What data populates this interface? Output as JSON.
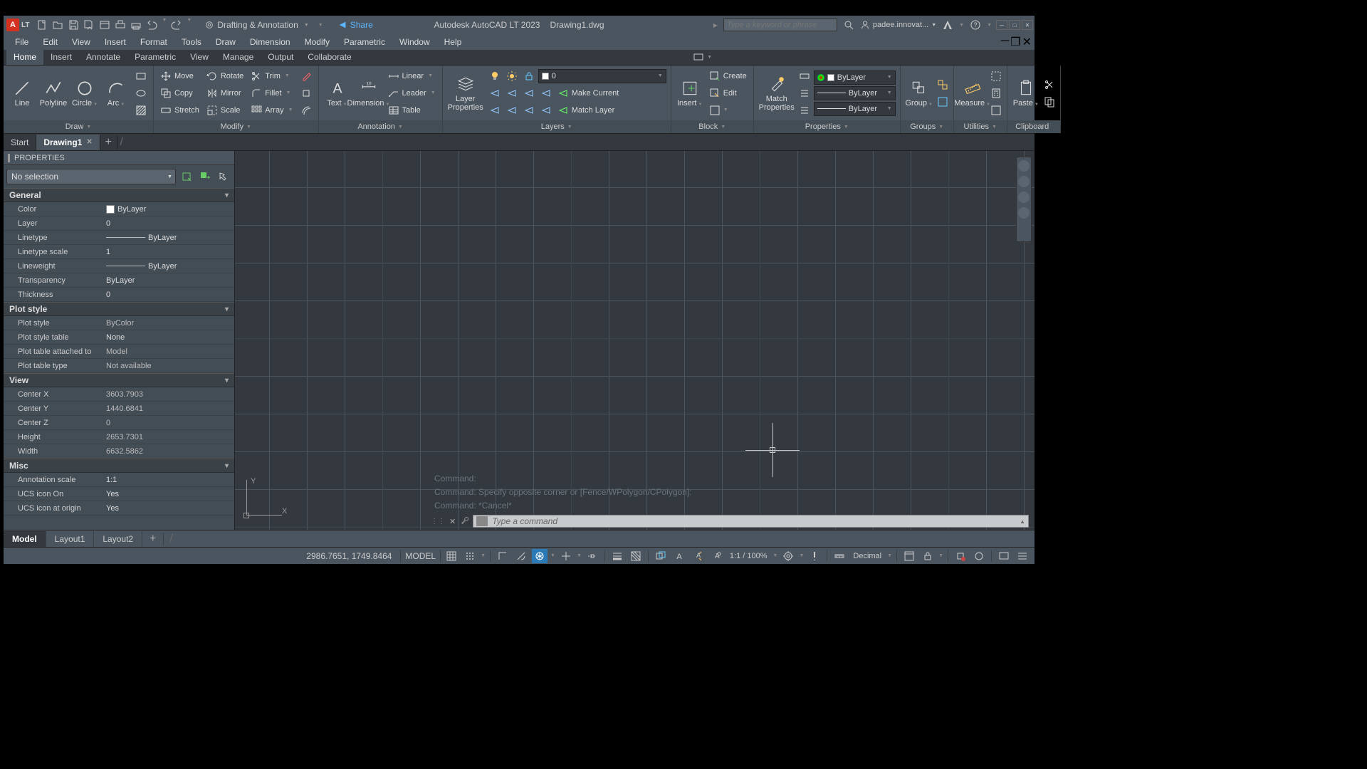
{
  "title": {
    "app": "Autodesk AutoCAD LT 2023",
    "doc": "Drawing1.dwg"
  },
  "workspace": "Drafting & Annotation",
  "share": "Share",
  "search": {
    "placeholder": "Type a keyword or phrase"
  },
  "user": "padee.innovat...",
  "menu": [
    "File",
    "Edit",
    "View",
    "Insert",
    "Format",
    "Tools",
    "Draw",
    "Dimension",
    "Modify",
    "Parametric",
    "Window",
    "Help"
  ],
  "ribbon_tabs": [
    "Home",
    "Insert",
    "Annotate",
    "Parametric",
    "View",
    "Manage",
    "Output",
    "Collaborate"
  ],
  "ribbon_active": 0,
  "panels": {
    "draw": {
      "title": "Draw",
      "line": "Line",
      "polyline": "Polyline",
      "circle": "Circle",
      "arc": "Arc"
    },
    "modify": {
      "title": "Modify",
      "move": "Move",
      "rotate": "Rotate",
      "trim": "Trim",
      "copy": "Copy",
      "mirror": "Mirror",
      "fillet": "Fillet",
      "stretch": "Stretch",
      "scale": "Scale",
      "array": "Array"
    },
    "annotation": {
      "title": "Annotation",
      "text": "Text",
      "dimension": "Dimension",
      "linear": "Linear",
      "leader": "Leader",
      "table": "Table"
    },
    "layers": {
      "title": "Layers",
      "props": "Layer\nProperties",
      "current": "0",
      "make_current": "Make Current",
      "match": "Match Layer"
    },
    "block": {
      "title": "Block",
      "insert": "Insert",
      "create": "Create",
      "edit": "Edit"
    },
    "properties": {
      "title": "Properties",
      "match": "Match\nProperties",
      "color": "ByLayer",
      "linew": "ByLayer",
      "ltype": "ByLayer"
    },
    "groups": {
      "title": "Groups",
      "group": "Group"
    },
    "utilities": {
      "title": "Utilities",
      "measure": "Measure"
    },
    "clipboard": {
      "title": "Clipboard",
      "paste": "Paste"
    }
  },
  "doc_tabs": {
    "start": "Start",
    "drawing": "Drawing1"
  },
  "palette": {
    "title": "PROPERTIES",
    "selection": "No selection",
    "sections": {
      "general": {
        "title": "General",
        "rows": [
          {
            "n": "Color",
            "v": "ByLayer",
            "swatch": true
          },
          {
            "n": "Layer",
            "v": "0"
          },
          {
            "n": "Linetype",
            "v": "ByLayer",
            "line": true
          },
          {
            "n": "Linetype scale",
            "v": "1"
          },
          {
            "n": "Lineweight",
            "v": "ByLayer",
            "line": true
          },
          {
            "n": "Transparency",
            "v": "ByLayer"
          },
          {
            "n": "Thickness",
            "v": "0"
          }
        ]
      },
      "plot": {
        "title": "Plot style",
        "rows": [
          {
            "n": "Plot style",
            "v": "ByColor",
            "ro": true
          },
          {
            "n": "Plot style table",
            "v": "None"
          },
          {
            "n": "Plot table attached to",
            "v": "Model",
            "ro": true
          },
          {
            "n": "Plot table type",
            "v": "Not available",
            "ro": true
          }
        ]
      },
      "view": {
        "title": "View",
        "rows": [
          {
            "n": "Center X",
            "v": "3603.7903",
            "ro": true
          },
          {
            "n": "Center Y",
            "v": "1440.6841",
            "ro": true
          },
          {
            "n": "Center Z",
            "v": "0",
            "ro": true
          },
          {
            "n": "Height",
            "v": "2653.7301",
            "ro": true
          },
          {
            "n": "Width",
            "v": "6632.5862",
            "ro": true
          }
        ]
      },
      "misc": {
        "title": "Misc",
        "rows": [
          {
            "n": "Annotation scale",
            "v": "1:1"
          },
          {
            "n": "UCS icon On",
            "v": "Yes"
          },
          {
            "n": "UCS icon at origin",
            "v": "Yes"
          }
        ]
      }
    }
  },
  "cmd_history": [
    "Command:",
    "Command: Specify opposite corner or [Fence/WPolygon/CPolygon]:",
    "Command: *Cancel*"
  ],
  "cmd_prompt": "Type a command",
  "layout_tabs": [
    "Model",
    "Layout1",
    "Layout2"
  ],
  "status": {
    "coords": "2986.7651, 1749.8464",
    "model": "MODEL",
    "scale": "1:1 / 100%",
    "units": "Decimal"
  },
  "ucs": {
    "x": "X",
    "y": "Y"
  }
}
